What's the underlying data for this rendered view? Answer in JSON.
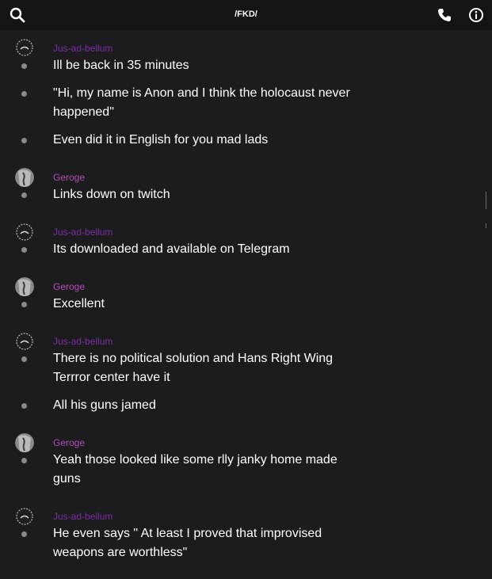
{
  "header": {
    "title": "/FKD/",
    "left_icon": "search-icon",
    "right_icons": [
      "phone-icon",
      "info-icon"
    ]
  },
  "colors": {
    "background": "#1c1c1f",
    "topbar": "#141416",
    "author_jus": "#7b2fa0",
    "author_geroge": "#b04fb0",
    "bullet": "#8a8a8a"
  },
  "messages": [
    {
      "author": "Jus-ad-bellum",
      "lines": [
        "Ill be back in 35 minutes"
      ]
    },
    {
      "author": "",
      "lines": [
        "\"Hi, my name is Anon and I think the holocaust never",
        "happened\""
      ]
    },
    {
      "author": "",
      "lines": [
        "Even did it in English for you mad lads"
      ]
    },
    {
      "author": "Geroge",
      "lines": [
        "Links down on twitch"
      ]
    },
    {
      "author": "Jus-ad-bellum",
      "lines": [
        "Its downloaded and available on Telegram"
      ]
    },
    {
      "author": "Geroge",
      "lines": [
        "Excellent"
      ]
    },
    {
      "author": "Jus-ad-bellum",
      "lines": [
        "There is no political solution and Hans Right Wing",
        "Terrror center have it"
      ]
    },
    {
      "author": "",
      "lines": [
        "All his guns jamed"
      ]
    },
    {
      "author": "Geroge",
      "lines": [
        "Yeah those looked like some rlly janky home made",
        "guns"
      ]
    },
    {
      "author": "Jus-ad-bellum",
      "lines": [
        "He even says \" At least I proved that improvised",
        "weapons are worthless\""
      ]
    }
  ]
}
